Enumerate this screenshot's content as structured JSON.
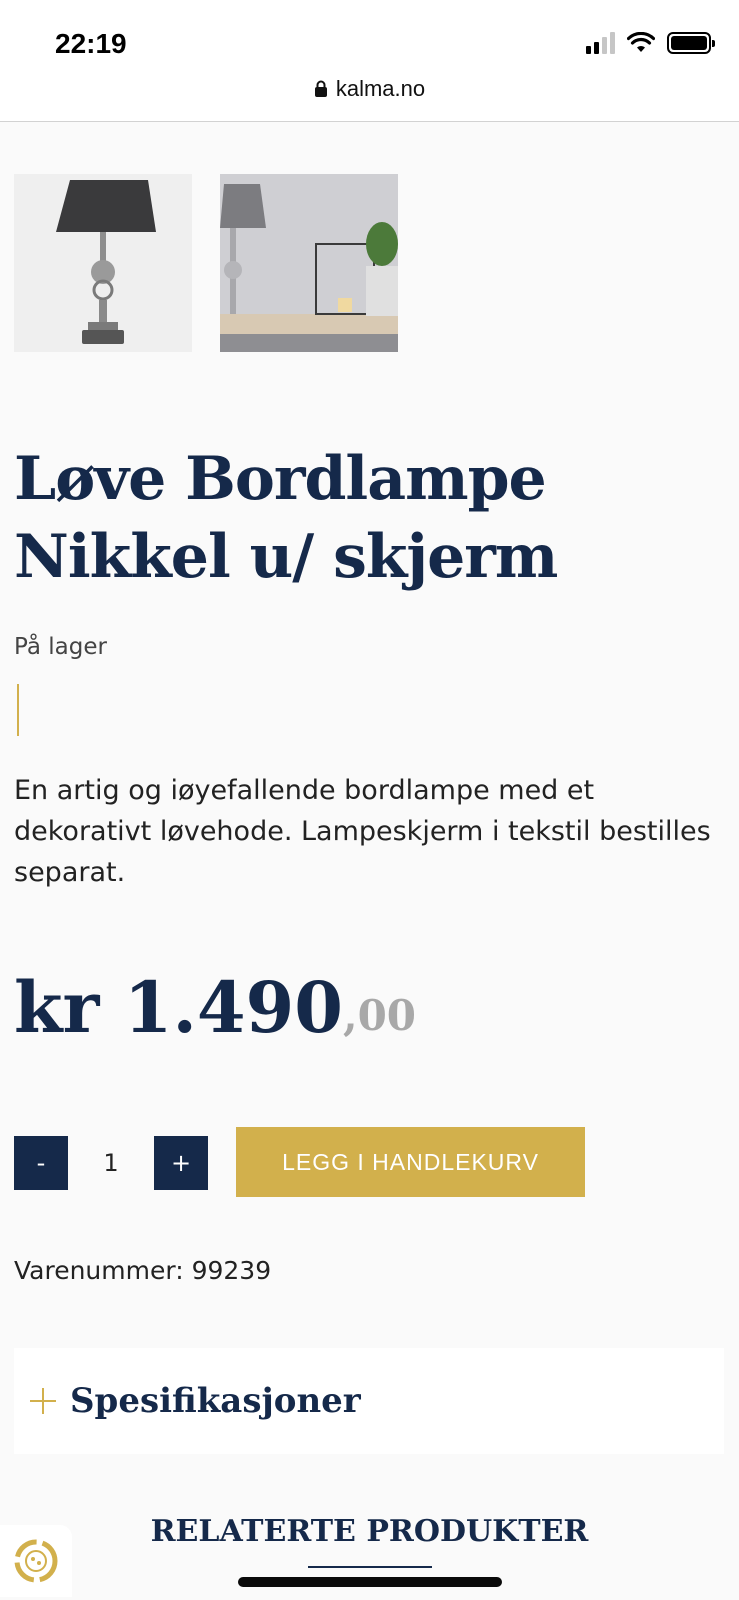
{
  "status_bar": {
    "time": "22:19",
    "url": "kalma.no",
    "icons": [
      "signal-icon",
      "wifi-icon",
      "battery-icon",
      "lock-icon"
    ]
  },
  "gallery": {
    "images": [
      "table-lamp-lion-head-photo",
      "table-lamp-room-scene-photo"
    ]
  },
  "product": {
    "title": "Løve Bordlampe Nikkel u/ skjerm",
    "stock": "På lager",
    "description": "En artig og iøyefallende bordlampe med et dekorativt løvehode. Lampeskjerm i tekstil bestilles separat.",
    "price_main": "kr 1.490",
    "price_decimals": ",00",
    "sku": "Varenummer: 99239"
  },
  "cart": {
    "minus_label": "-",
    "quantity": "1",
    "plus_label": "+",
    "add_label": "LEGG I HANDLEKURV"
  },
  "sections": {
    "specs_title": "Spesifikasjoner",
    "related_title": "RELATERTE PRODUKTER"
  },
  "colors": {
    "navy": "#15294a",
    "gold": "#d2b04c",
    "background": "#fafafa"
  }
}
